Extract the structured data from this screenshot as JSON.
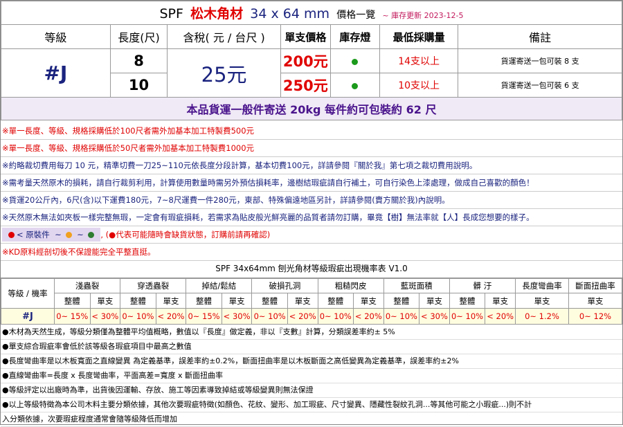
{
  "title": {
    "spf": "SPF",
    "name": "松木角材",
    "dim": "34 x 64 mm",
    "label": "價格一覽",
    "date": "~ 庫存更新 2023-12-5"
  },
  "headers": [
    "等級",
    "長度(尺)",
    "含稅( 元 / 台尺 )",
    "單支價格",
    "庫存燈",
    "最低採購量",
    "備註"
  ],
  "grade": "#J",
  "price_per_unit": "25元",
  "rows": [
    {
      "length": "8",
      "unit_price": "200元",
      "stock_color": "#1b9a1b",
      "min_buy": "14支以上",
      "note": "貨運寄送一包可裝 8 支"
    },
    {
      "length": "10",
      "unit_price": "250元",
      "stock_color": "#1b9a1b",
      "min_buy": "10支以上",
      "note": "貨運寄送一包可裝 6 支"
    }
  ],
  "shipping": "本品貨運一般件寄送 20kg 每件約可包裝約 62 尺",
  "notes": [
    {
      "style": "red",
      "text": "※單一長度、等級、規格採購低於100尺者需外加基本加工特製費500元"
    },
    {
      "style": "red",
      "text": "※單一長度、等級、規格採購低於50尺者需外加基本加工特製費1000元"
    },
    {
      "style": "blue",
      "text": "※約略裁切費用每刀 10 元，精準切費一刀25~110元依長度分段計算，基本切費100元，詳請參閱『關於我』第七項之裁切費用說明。"
    },
    {
      "style": "blue",
      "text": "※需考量天然原木的損耗，請自行裁剪利用，計算使用數量時需另外預估損耗率，邊樹結瑕疵請自行補土，可自行染色上漆處理，做成自己喜歡的顏色！"
    },
    {
      "style": "blue",
      "text": "※貨運20公斤內，6尺(含)以下運費180元，7~8尺運費一件280元，東部、特殊偏遠地區另計，詳請參閱(賣方關於我)內說明。"
    },
    {
      "style": "blue",
      "text": "※天然原木無法如夾板一樣完整無瑕，一定會有瑕疵損耗，若需求為貼皮般光鮮亮麗的品質者請勿訂購，畢竟【樹】無法率就【人】長成您想要的樣子。"
    }
  ],
  "status": {
    "label": "< 原裝件",
    "sep": "~",
    "colors": [
      "#e00000",
      "#f0a020",
      "#2e7d32"
    ],
    "note": "(●代表可能隨時會缺貨狀態，訂購前請再確認)"
  },
  "kd_note": "※KD原料經剖切後不保證能完全平整直挺。",
  "defect": {
    "title": "SPF 34x64mm 刨光角材等級瑕疵出現機率表 V1.0",
    "grade_header": "等級 / 機率",
    "categories": [
      "淺蟲裂",
      "穿透蟲裂",
      "掉結/鬆結",
      "破損孔洞",
      "粗糙閃皮",
      "藍斑面積",
      "髒 汙",
      "長度彎曲率",
      "斷面扭曲率"
    ],
    "sub_whole": "整體",
    "sub_single": "單支",
    "grade": "#J",
    "values": [
      "0~ 15%",
      "< 30%",
      "0~ 10%",
      "< 20%",
      "0~ 15%",
      "< 30%",
      "0~ 10%",
      "< 20%",
      "0~ 10%",
      "< 20%",
      "0~ 10%",
      "< 30%",
      "0~ 10%",
      "< 20%",
      "0~ 1.2%",
      "0~ 12%"
    ]
  },
  "footer": [
    "●木材為天然生成，等級分類僅為整體平均值概略，數值以『長度』做定義，非以『支數』計算，分類誤差率約± 5%",
    "●單支綜合瑕疵率會低於該等級各瑕疵項目中最高之數值",
    "●長度彎曲率是以木板寬面之直線變異 為定義基準，誤差率約±0.2%，斷面扭曲率是以木板斷面之高低變異為定義基準，誤差率約±2%",
    "●直線彎曲率=長度 x 長度彎曲率，平面高差=寬度 x 斷面扭曲率",
    "●等級評定以出廠時為準，出貨後因運輸、存放、施工等因素導致掉結或等級變異則無法保證",
    "●以上等級特徵為本公司木料主要分類依據，其他次要瑕疵特徵(如顏色、花紋、變形、加工瑕疵、尺寸變異、隱藏性裂紋孔洞...等其他可能之小瑕疵...)則不計",
    "入分類依據，次要瑕疵程度通常會隨等級降低而增加"
  ]
}
